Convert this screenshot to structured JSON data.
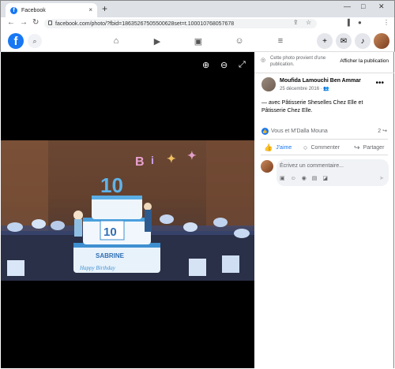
{
  "browser": {
    "tab_title": "Facebook",
    "tab_close": "×",
    "new_tab": "+",
    "url": "facebook.com/photo/?fbid=18635267505500628set=t.100010768057678",
    "window_controls": [
      "—",
      "□",
      "✕"
    ]
  },
  "fb_nav": {
    "logo": "f",
    "icons": [
      "home-icon",
      "video-icon",
      "marketplace-icon",
      "groups-icon",
      "menu-icon"
    ],
    "right_buttons": [
      "+",
      "messenger-icon",
      "bell-icon",
      "avatar"
    ]
  },
  "photo": {
    "cake_number_top": "10",
    "cake_number_middle": "10",
    "cake_name": "SABRINE",
    "cake_text": "Happy Birthday"
  },
  "sidebar": {
    "notice_text": "Cette photo provient d'une publication.",
    "notice_action": "Afficher la publication",
    "author": "Moufida Lamouchi Ben Ammar",
    "date": "25 décembre 2016 · ",
    "post_text": "— avec Pâtisserie Sheselles Chez Elle et Pâtisserie Chez Elle.",
    "reactions": "Vous et M'Dalla Mouna",
    "share_count": "2",
    "actions": {
      "like": "J'aime",
      "comment": "Commenter",
      "share": "Partager"
    },
    "comment_placeholder": "Écrivez un commentaire..."
  }
}
